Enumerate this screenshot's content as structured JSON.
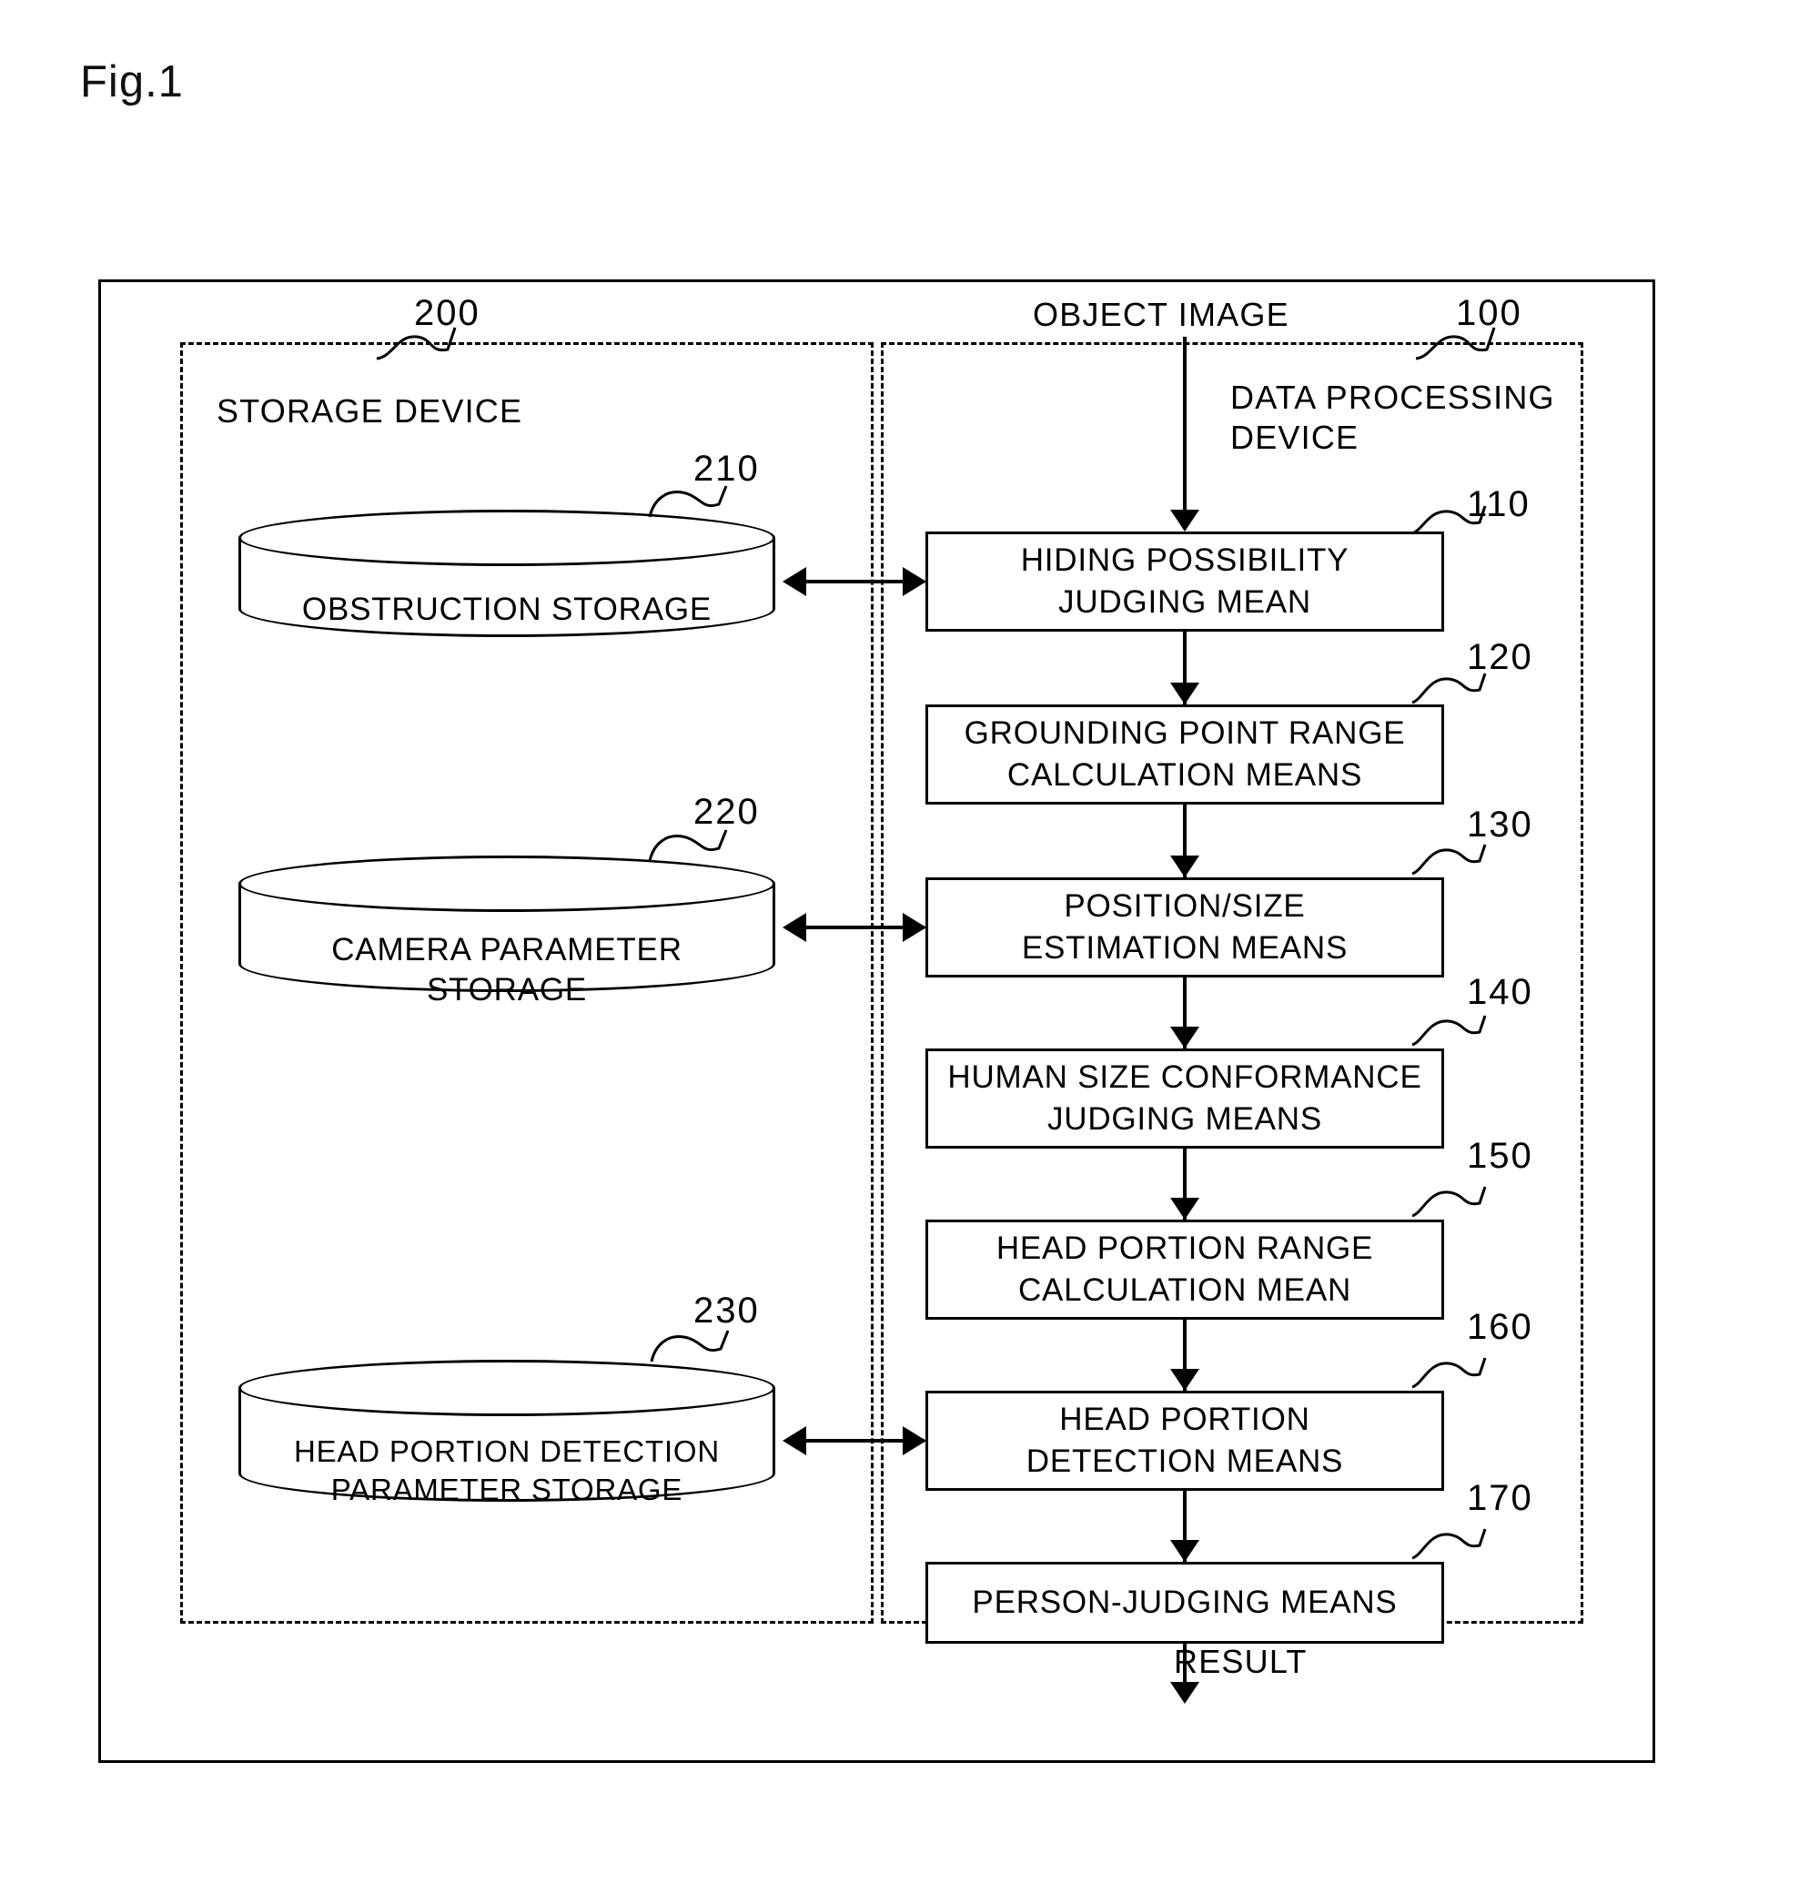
{
  "figure": {
    "title": "Fig.1"
  },
  "labels": {
    "object_image": "OBJECT IMAGE",
    "result": "RESULT",
    "storage_device": "STORAGE DEVICE",
    "data_processing_device": "DATA PROCESSING\nDEVICE"
  },
  "refs": {
    "storage_device": "200",
    "data_processing_device": "100",
    "obstruction_storage": "210",
    "camera_parameter_storage": "220",
    "head_portion_detection_parameter_storage": "230",
    "hiding_possibility": "110",
    "grounding_point_range": "120",
    "position_size": "130",
    "human_size_conformance": "140",
    "head_portion_range": "150",
    "head_portion_detection": "160",
    "person_judging": "170"
  },
  "storage_units": [
    {
      "id": "obstruction-storage",
      "label": "OBSTRUCTION STORAGE",
      "ref": "210"
    },
    {
      "id": "camera-parameter-storage",
      "label": "CAMERA PARAMETER\nSTORAGE",
      "ref": "220"
    },
    {
      "id": "head-portion-detection-parameter-storage",
      "label": "HEAD PORTION DETECTION\nPARAMETER STORAGE",
      "ref": "230"
    }
  ],
  "process_units": [
    {
      "id": "hiding-possibility-judging-mean",
      "label": "HIDING POSSIBILITY\nJUDGING MEAN",
      "ref": "110"
    },
    {
      "id": "grounding-point-range-calculation-means",
      "label": "GROUNDING POINT RANGE\nCALCULATION MEANS",
      "ref": "120"
    },
    {
      "id": "position-size-estimation-means",
      "label": "POSITION/SIZE\nESTIMATION MEANS",
      "ref": "130"
    },
    {
      "id": "human-size-conformance-judging-means",
      "label": "HUMAN SIZE CONFORMANCE\nJUDGING MEANS",
      "ref": "140"
    },
    {
      "id": "head-portion-range-calculation-mean",
      "label": "HEAD PORTION RANGE\nCALCULATION MEAN",
      "ref": "150"
    },
    {
      "id": "head-portion-detection-means",
      "label": "HEAD PORTION\nDETECTION MEANS",
      "ref": "160"
    },
    {
      "id": "person-judging-means",
      "label": "PERSON-JUDGING MEANS",
      "ref": "170"
    }
  ]
}
